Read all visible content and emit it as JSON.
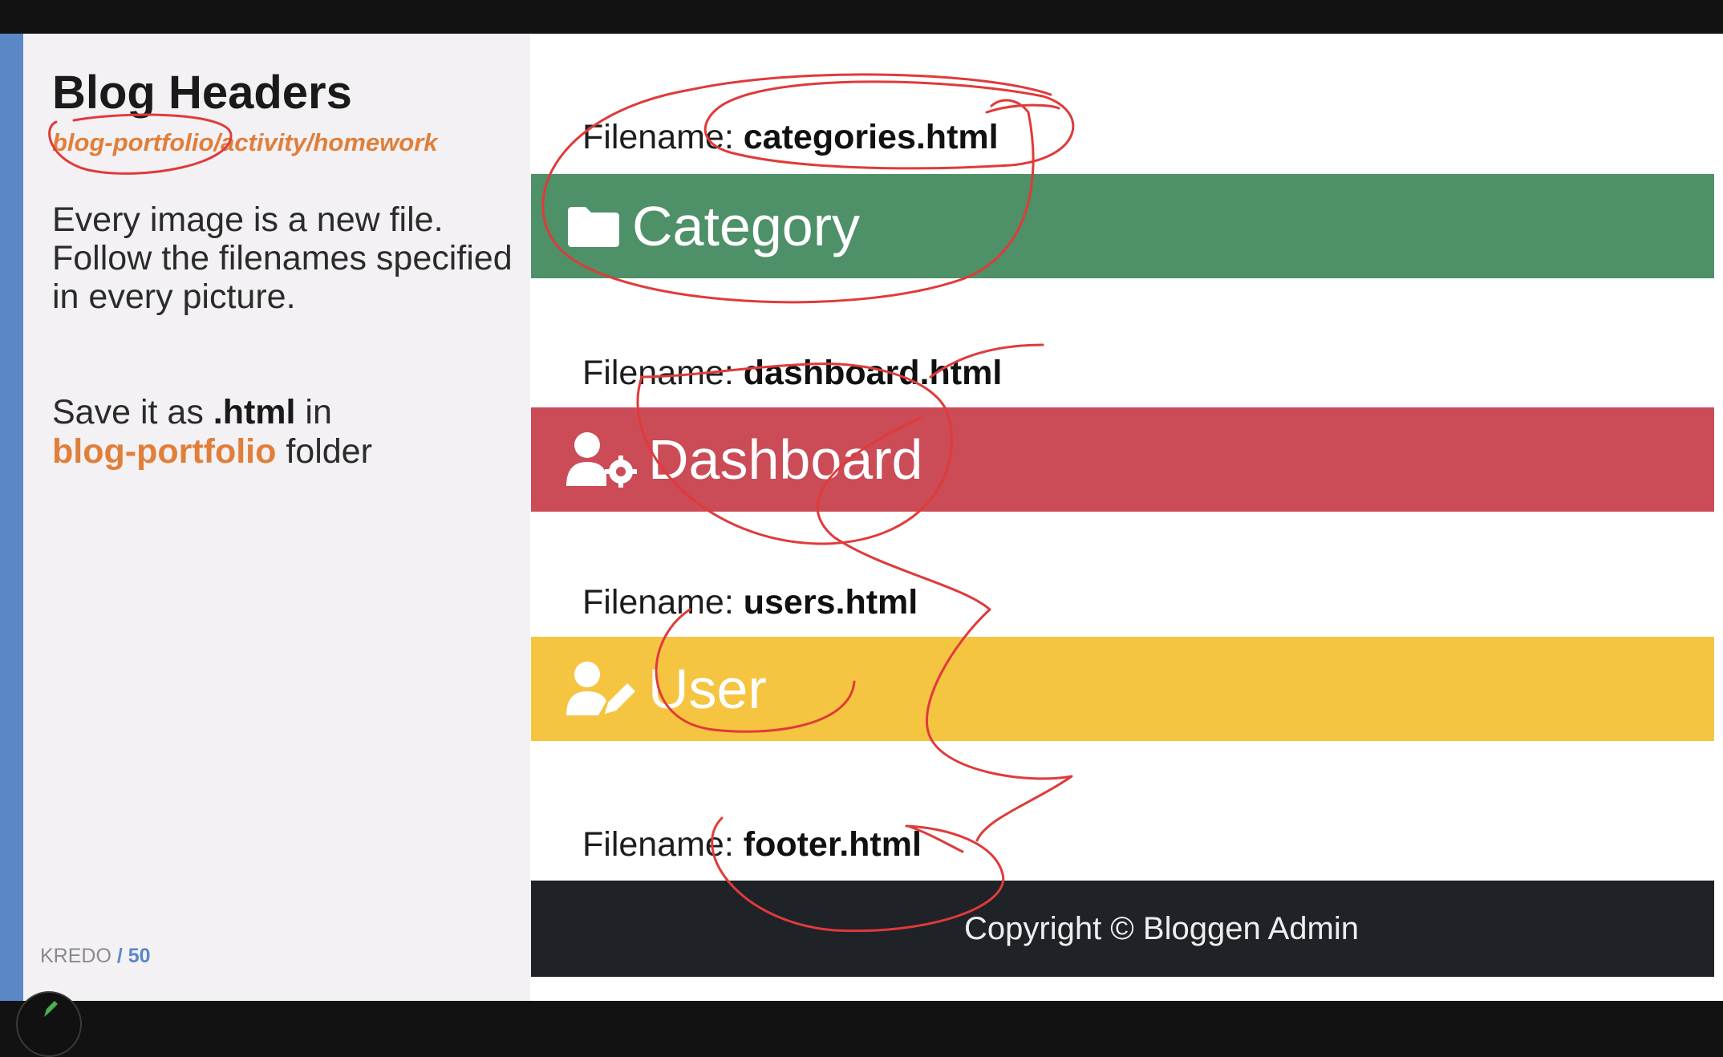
{
  "slide": {
    "title": "Blog Headers",
    "subtitle": "blog-portfolio/activity/homework",
    "instructions": "Every image is a new file. Follow the filenames specified in every picture.",
    "save_prefix": "Save it as ",
    "save_ext": ".html",
    "save_mid": " in",
    "save_folder": "blog-portfolio",
    "save_suffix": " folder",
    "brand": "KREDO",
    "page_sep": " / ",
    "page_number": "50"
  },
  "headers": {
    "filename_label": "Filename: ",
    "categories_file": "categories.html",
    "categories_title": "Category",
    "dashboard_file": "dashboard.html",
    "dashboard_title": "Dashboard",
    "users_file": "users.html",
    "users_title": "User",
    "footer_file": "footer.html",
    "footer_text": "Copyright © Bloggen Admin"
  },
  "icons": {
    "category": "folder-icon",
    "dashboard": "user-gear-icon",
    "user": "user-edit-icon",
    "tool": "pen-icon"
  },
  "colors": {
    "accent_blue": "#5b87c7",
    "orange": "#e07f3a",
    "green": "#4e9068",
    "red": "#cb4b57",
    "yellow": "#f5c542",
    "dark": "#1f2226",
    "annotation": "#e03a3a"
  }
}
